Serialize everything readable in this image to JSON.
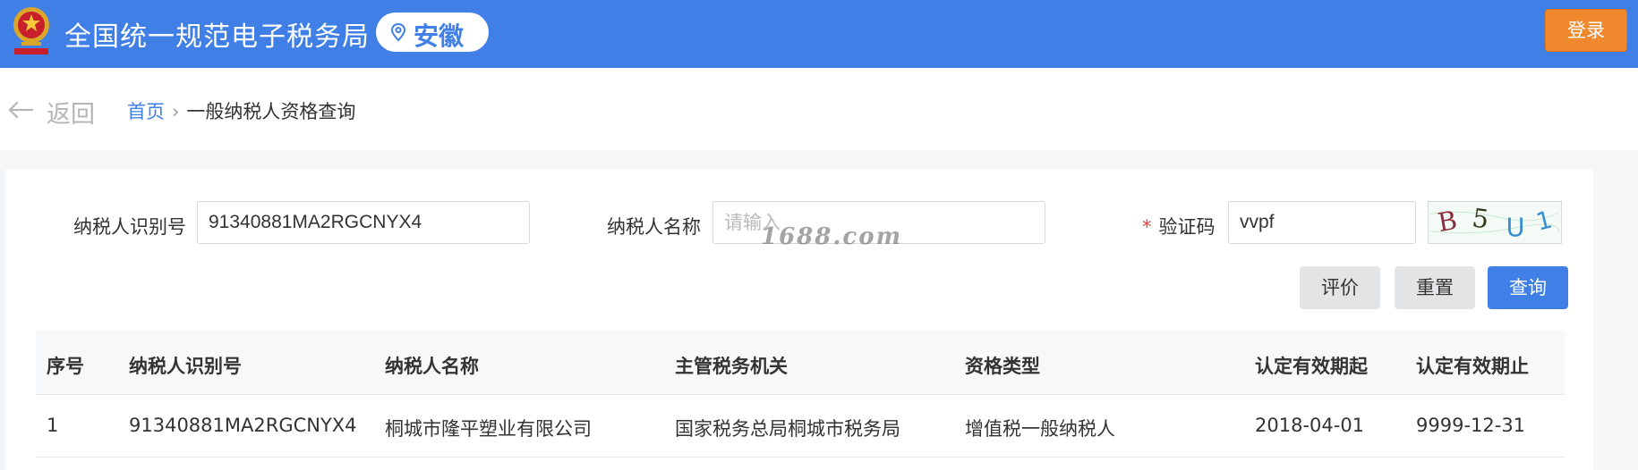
{
  "header": {
    "site_title": "全国统一规范电子税务局",
    "region": "安徽",
    "login_label": "登录",
    "brand_color": "#3f7fe6",
    "login_color": "#f0892e"
  },
  "nav": {
    "back_label": "返回",
    "breadcrumb_home": "首页",
    "breadcrumb_separator": "›",
    "breadcrumb_current": "一般纳税人资格查询"
  },
  "form": {
    "taxpayer_id_label": "纳税人识别号",
    "taxpayer_id_value": "91340881MA2RGCNYX4",
    "taxpayer_name_label": "纳税人名称",
    "taxpayer_name_placeholder": "请输入",
    "captcha_required_mark": "*",
    "captcha_label": "验证码",
    "captcha_value": "vvpf",
    "captcha_image_text": "B5U1"
  },
  "watermark": "1688.com",
  "actions": {
    "evaluate_label": "评价",
    "reset_label": "重置",
    "query_label": "查询"
  },
  "table": {
    "columns": [
      "序号",
      "纳税人识别号",
      "纳税人名称",
      "主管税务机关",
      "资格类型",
      "认定有效期起",
      "认定有效期止"
    ],
    "rows": [
      [
        "1",
        "91340881MA2RGCNYX4",
        "桐城市隆平塑业有限公司",
        "国家税务总局桐城市税务局",
        "增值税一般纳税人",
        "2018-04-01",
        "9999-12-31"
      ]
    ]
  }
}
